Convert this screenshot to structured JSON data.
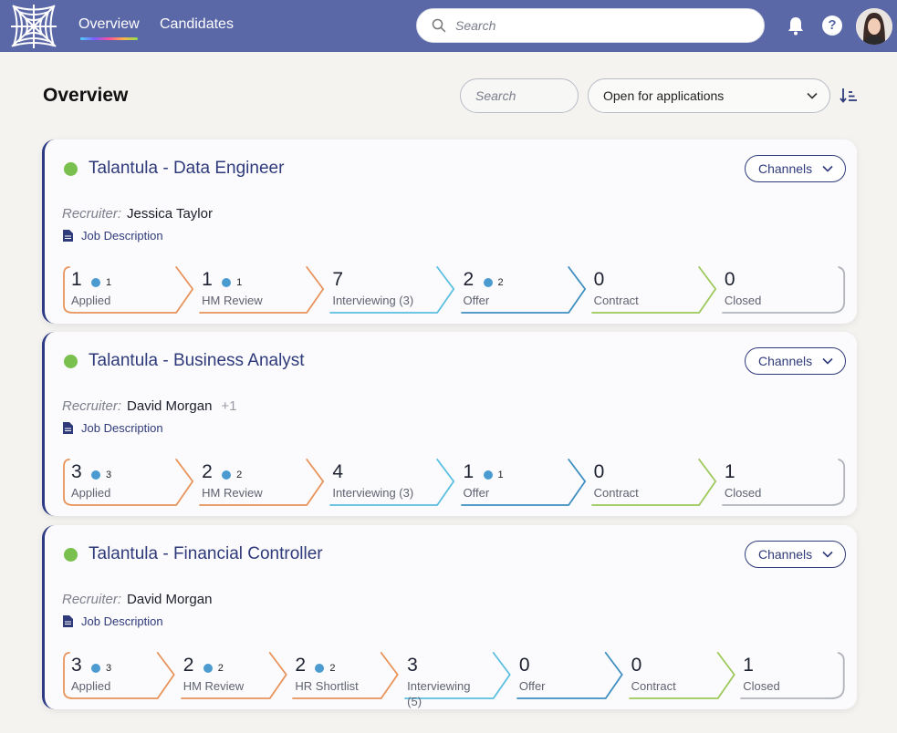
{
  "nav": {
    "tabs": [
      {
        "label": "Overview",
        "active": true
      },
      {
        "label": "Candidates",
        "active": false
      }
    ],
    "search_placeholder": "Search",
    "help_label": "?"
  },
  "page": {
    "title": "Overview",
    "search_placeholder": "Search",
    "status_filter": "Open for applications"
  },
  "colors": {
    "topbar": "#5b68a8",
    "accent": "#2f3a7a",
    "status_active": "#7ac04f",
    "badge": "#4b9bd1",
    "stage_orange": "#e8935a",
    "stage_blue": "#5bbfe0",
    "stage_teal": "#3f8fc0",
    "stage_green": "#9cc95a",
    "stage_grey": "#b0b3bb"
  },
  "jobs": [
    {
      "title": "Talantula - Data Engineer",
      "recruiter_label": "Recruiter:",
      "recruiter": "Jessica Taylor",
      "recruiter_extra": "",
      "channels_label": "Channels",
      "job_description_label": "Job Description",
      "stages": [
        {
          "count": "1",
          "badge": "1",
          "label": "Applied",
          "label2": "",
          "color": "stage_orange"
        },
        {
          "count": "1",
          "badge": "1",
          "label": "HM Review",
          "label2": "",
          "color": "stage_orange"
        },
        {
          "count": "7",
          "badge": "",
          "label": "Interviewing (3)",
          "label2": "",
          "color": "stage_blue"
        },
        {
          "count": "2",
          "badge": "2",
          "label": "Offer",
          "label2": "",
          "color": "stage_teal"
        },
        {
          "count": "0",
          "badge": "",
          "label": "Contract",
          "label2": "",
          "color": "stage_green"
        },
        {
          "count": "0",
          "badge": "",
          "label": "Closed",
          "label2": "",
          "color": "stage_grey"
        }
      ]
    },
    {
      "title": "Talantula - Business Analyst",
      "recruiter_label": "Recruiter:",
      "recruiter": "David Morgan",
      "recruiter_extra": "+1",
      "channels_label": "Channels",
      "job_description_label": "Job Description",
      "stages": [
        {
          "count": "3",
          "badge": "3",
          "label": "Applied",
          "label2": "",
          "color": "stage_orange"
        },
        {
          "count": "2",
          "badge": "2",
          "label": "HM Review",
          "label2": "",
          "color": "stage_orange"
        },
        {
          "count": "4",
          "badge": "",
          "label": "Interviewing (3)",
          "label2": "",
          "color": "stage_blue"
        },
        {
          "count": "1",
          "badge": "1",
          "label": "Offer",
          "label2": "",
          "color": "stage_teal"
        },
        {
          "count": "0",
          "badge": "",
          "label": "Contract",
          "label2": "",
          "color": "stage_green"
        },
        {
          "count": "1",
          "badge": "",
          "label": "Closed",
          "label2": "",
          "color": "stage_grey"
        }
      ]
    },
    {
      "title": "Talantula - Financial Controller",
      "recruiter_label": "Recruiter:",
      "recruiter": "David Morgan",
      "recruiter_extra": "",
      "channels_label": "Channels",
      "job_description_label": "Job Description",
      "stages": [
        {
          "count": "3",
          "badge": "3",
          "label": "Applied",
          "label2": "",
          "color": "stage_orange"
        },
        {
          "count": "2",
          "badge": "2",
          "label": "HM Review",
          "label2": "",
          "color": "stage_orange"
        },
        {
          "count": "2",
          "badge": "2",
          "label": "HR Shortlist",
          "label2": "",
          "color": "stage_orange"
        },
        {
          "count": "3",
          "badge": "",
          "label": "Interviewing",
          "label2": "(5)",
          "color": "stage_blue"
        },
        {
          "count": "0",
          "badge": "",
          "label": "Offer",
          "label2": "",
          "color": "stage_teal"
        },
        {
          "count": "0",
          "badge": "",
          "label": "Contract",
          "label2": "",
          "color": "stage_green"
        },
        {
          "count": "1",
          "badge": "",
          "label": "Closed",
          "label2": "",
          "color": "stage_grey"
        }
      ]
    }
  ]
}
